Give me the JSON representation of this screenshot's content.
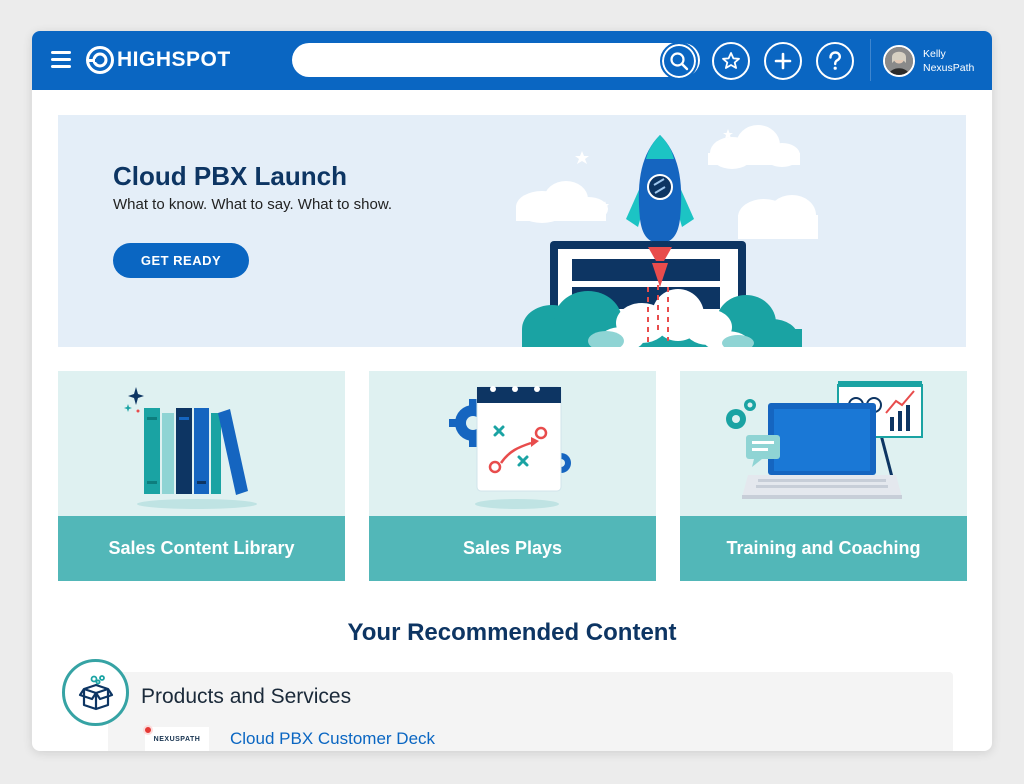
{
  "header": {
    "logo_text": "HIGHSPOT",
    "search_placeholder": "",
    "user": {
      "first_name": "Kelly",
      "last_name": "NexusPath"
    }
  },
  "hero": {
    "title": "Cloud PBX Launch",
    "subtitle": "What to know. What to say. What to show.",
    "button_label": "GET READY"
  },
  "cards": [
    {
      "label": "Sales Content Library"
    },
    {
      "label": "Sales Plays"
    },
    {
      "label": "Training and Coaching"
    }
  ],
  "recommended": {
    "title": "Your Recommended Content",
    "category": "Products and Services",
    "items": [
      {
        "thumb_text": "NEXUSPATH",
        "title": "Cloud PBX Customer Deck"
      }
    ]
  },
  "colors": {
    "brand_blue": "#0a66c2",
    "navy": "#0d3563",
    "teal": "#52b7b8",
    "hero_bg": "#e4eef8",
    "card_bg": "#dff1f1"
  }
}
